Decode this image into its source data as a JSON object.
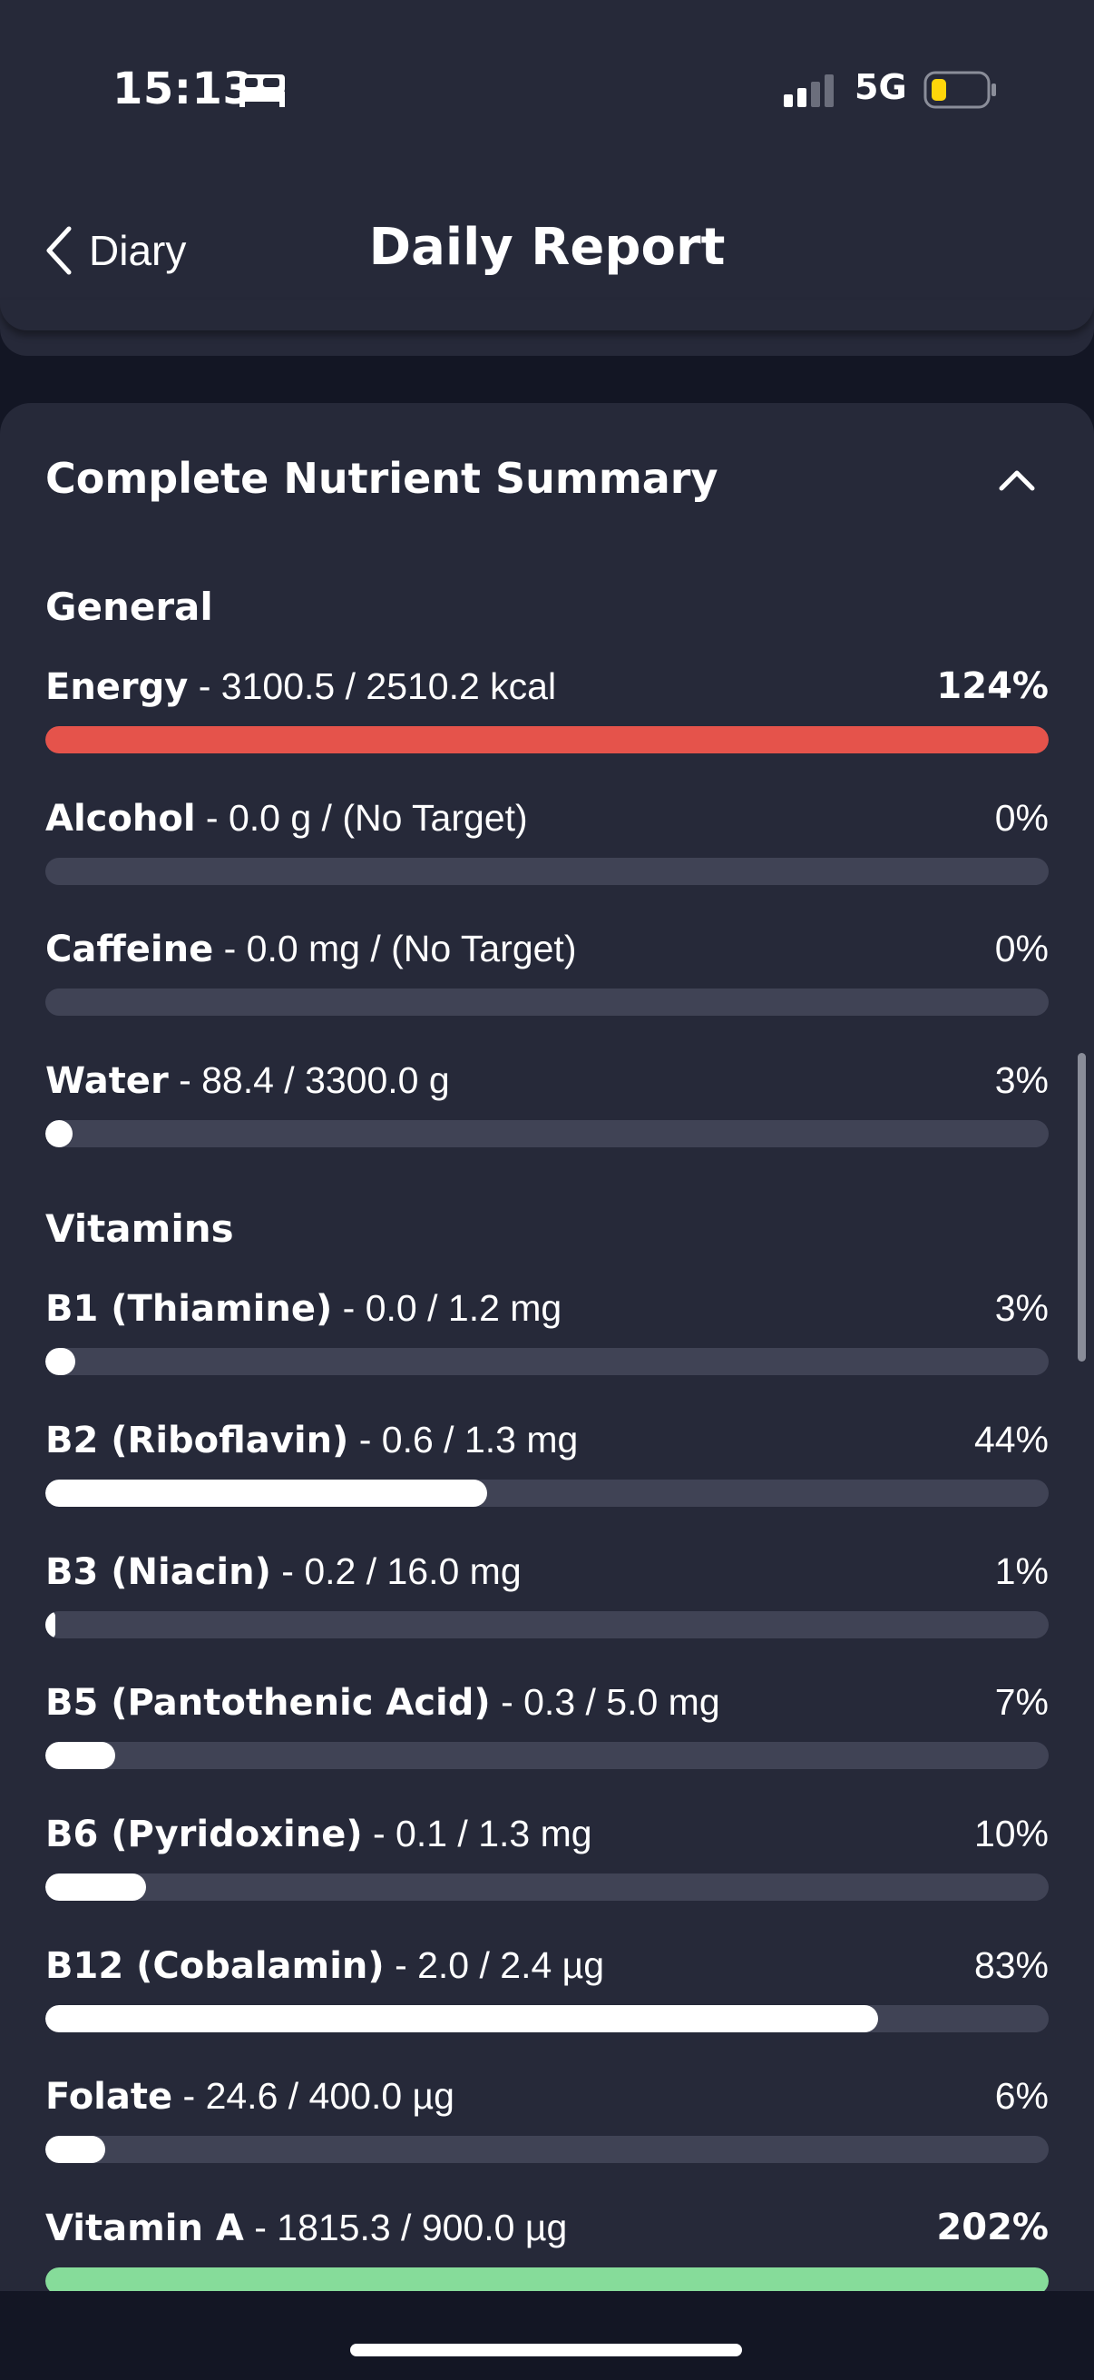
{
  "status_bar": {
    "time": "15:13",
    "focus_icon": "bed-icon",
    "signal_icon": "cellular-signal-icon",
    "network": "5G",
    "battery_icon": "battery-low-icon",
    "battery_color": "#ffd60a"
  },
  "nav": {
    "back_label": "Diary",
    "back_icon": "chevron-left-icon",
    "title": "Daily Report"
  },
  "summary": {
    "title": "Complete Nutrient Summary",
    "collapse_icon": "chevron-up-icon",
    "colors": {
      "over": "#e5534b",
      "normal": "#ffffff",
      "good": "#86dc9a",
      "track": "#404355"
    },
    "sections": [
      {
        "label": "General",
        "items": [
          {
            "name": "Energy",
            "detail": " - 3100.5 / 2510.2 kcal",
            "percent_text": "124%",
            "fill_fraction": 1.0,
            "status": "over"
          },
          {
            "name": "Alcohol",
            "detail": " - 0.0 g / (No Target)",
            "percent_text": "0%",
            "fill_fraction": 0.0,
            "status": "normal"
          },
          {
            "name": "Caffeine",
            "detail": " - 0.0 mg / (No Target)",
            "percent_text": "0%",
            "fill_fraction": 0.0,
            "status": "normal"
          },
          {
            "name": "Water",
            "detail": " - 88.4 / 3300.0 g",
            "percent_text": "3%",
            "fill_fraction": 0.027,
            "status": "normal"
          }
        ]
      },
      {
        "label": "Vitamins",
        "items": [
          {
            "name": "B1 (Thiamine)",
            "detail": " - 0.0 / 1.2 mg",
            "percent_text": "3%",
            "fill_fraction": 0.03,
            "status": "normal"
          },
          {
            "name": "B2 (Riboflavin)",
            "detail": " - 0.6 / 1.3 mg",
            "percent_text": "44%",
            "fill_fraction": 0.44,
            "status": "normal"
          },
          {
            "name": "B3 (Niacin)",
            "detail": " - 0.2 / 16.0 mg",
            "percent_text": "1%",
            "fill_fraction": 0.01,
            "status": "normal"
          },
          {
            "name": "B5 (Pantothenic Acid)",
            "detail": " - 0.3 / 5.0 mg",
            "percent_text": "7%",
            "fill_fraction": 0.07,
            "status": "normal"
          },
          {
            "name": "B6 (Pyridoxine)",
            "detail": " - 0.1 / 1.3 mg",
            "percent_text": "10%",
            "fill_fraction": 0.1,
            "status": "normal"
          },
          {
            "name": "B12 (Cobalamin)",
            "detail": " - 2.0 / 2.4 µg",
            "percent_text": "83%",
            "fill_fraction": 0.83,
            "status": "normal"
          },
          {
            "name": "Folate",
            "detail": " - 24.6 / 400.0 µg",
            "percent_text": "6%",
            "fill_fraction": 0.06,
            "status": "normal"
          },
          {
            "name": "Vitamin A",
            "detail": " - 1815.3 / 900.0 µg",
            "percent_text": "202%",
            "fill_fraction": 1.0,
            "status": "good"
          }
        ]
      }
    ]
  }
}
